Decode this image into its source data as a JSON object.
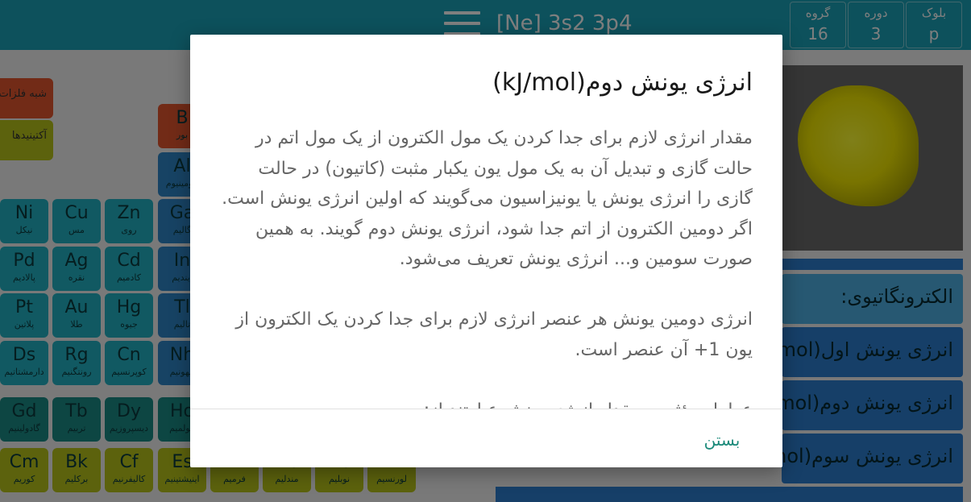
{
  "topbar": {
    "configuration": "[Ne] 3s2 3p4",
    "info": [
      {
        "label": "بلوک",
        "value": "p"
      },
      {
        "label": "دوره",
        "value": "3"
      },
      {
        "label": "گروه",
        "value": "16"
      }
    ]
  },
  "legend": [
    {
      "label": "شبه فلزات",
      "color": "#e4572e"
    },
    {
      "label": "آکتینیدها",
      "color": "#b9c51a"
    }
  ],
  "table": {
    "cells": [
      {
        "sym": "B",
        "nm": "بور"
      },
      {
        "sym": "Al",
        "nm": "آلومینیوم"
      },
      {
        "sym": "Ni",
        "nm": "نیکل"
      },
      {
        "sym": "Cu",
        "nm": "مس"
      },
      {
        "sym": "Zn",
        "nm": "روی"
      },
      {
        "sym": "Ga",
        "nm": "گالیم"
      },
      {
        "sym": "Pd",
        "nm": "پالادیم"
      },
      {
        "sym": "Ag",
        "nm": "نقره"
      },
      {
        "sym": "Cd",
        "nm": "کادمیم"
      },
      {
        "sym": "In",
        "nm": "ایندیم"
      },
      {
        "sym": "Pt",
        "nm": "پلاتین"
      },
      {
        "sym": "Au",
        "nm": "طلا"
      },
      {
        "sym": "Hg",
        "nm": "جیوه"
      },
      {
        "sym": "Tl",
        "nm": "تالیم"
      },
      {
        "sym": "Ds",
        "nm": "دارمشتاتیم"
      },
      {
        "sym": "Rg",
        "nm": "رونتگنیم"
      },
      {
        "sym": "Cn",
        "nm": "کوپرنسیم"
      },
      {
        "sym": "Nh",
        "nm": "نیهونیم"
      },
      {
        "sym": "Gd",
        "nm": "گادولینیم"
      },
      {
        "sym": "Tb",
        "nm": "تربیم"
      },
      {
        "sym": "Dy",
        "nm": "دیسپروزیم"
      },
      {
        "sym": "Ho",
        "nm": "هولمیم"
      },
      {
        "sym": "Cm",
        "nm": "کوریم"
      },
      {
        "sym": "Bk",
        "nm": "برکلیم"
      },
      {
        "sym": "Cf",
        "nm": "کالیفرنیم"
      },
      {
        "sym": "Es",
        "nm": "اینیشتینیم"
      },
      {
        "sym": "Fm",
        "nm": "فرمیم"
      },
      {
        "sym": "Md",
        "nm": "مندلیم"
      },
      {
        "sym": "No",
        "nm": "نوبلیم"
      },
      {
        "sym": "Lr",
        "nm": "لورنسیم"
      }
    ]
  },
  "properties": {
    "electronegativity": "الکترونگاتیوی:",
    "ionization1": "انرژی یونش اول(kJ/mol)",
    "ionization2": "انرژی یونش دوم(kJ/mol)",
    "ionization3": "انرژی یونش سوم(kJ/mol)"
  },
  "dialog": {
    "title": "انرژی یونش دوم(kJ/mol)",
    "paragraphs": [
      "مقدار انرژی لازم برای جدا کردن یک مول الکترون از یک مول اتم در حالت گازی و تبدیل آن به یک مول یون یکبار مثبت (کاتیون) در حالت گازی را انرژی یونش یا یونیزاسیون می‌گویند که اولین انرژی یونش است. اگر دومین الکترون از اتم جدا شود، انرژی یونش دوم گویند. به همین صورت سومین و... انرژی یونش تعریف می‌شود.",
      "انرژی دومین یونش هر عنصر انرژی لازم برای جدا کردن یک الکترون از یون 1+ آن عنصر است.",
      "عوامل مؤثر بر مقدار انرژی یونش عبارتند از:"
    ],
    "close_label": "بستن"
  }
}
